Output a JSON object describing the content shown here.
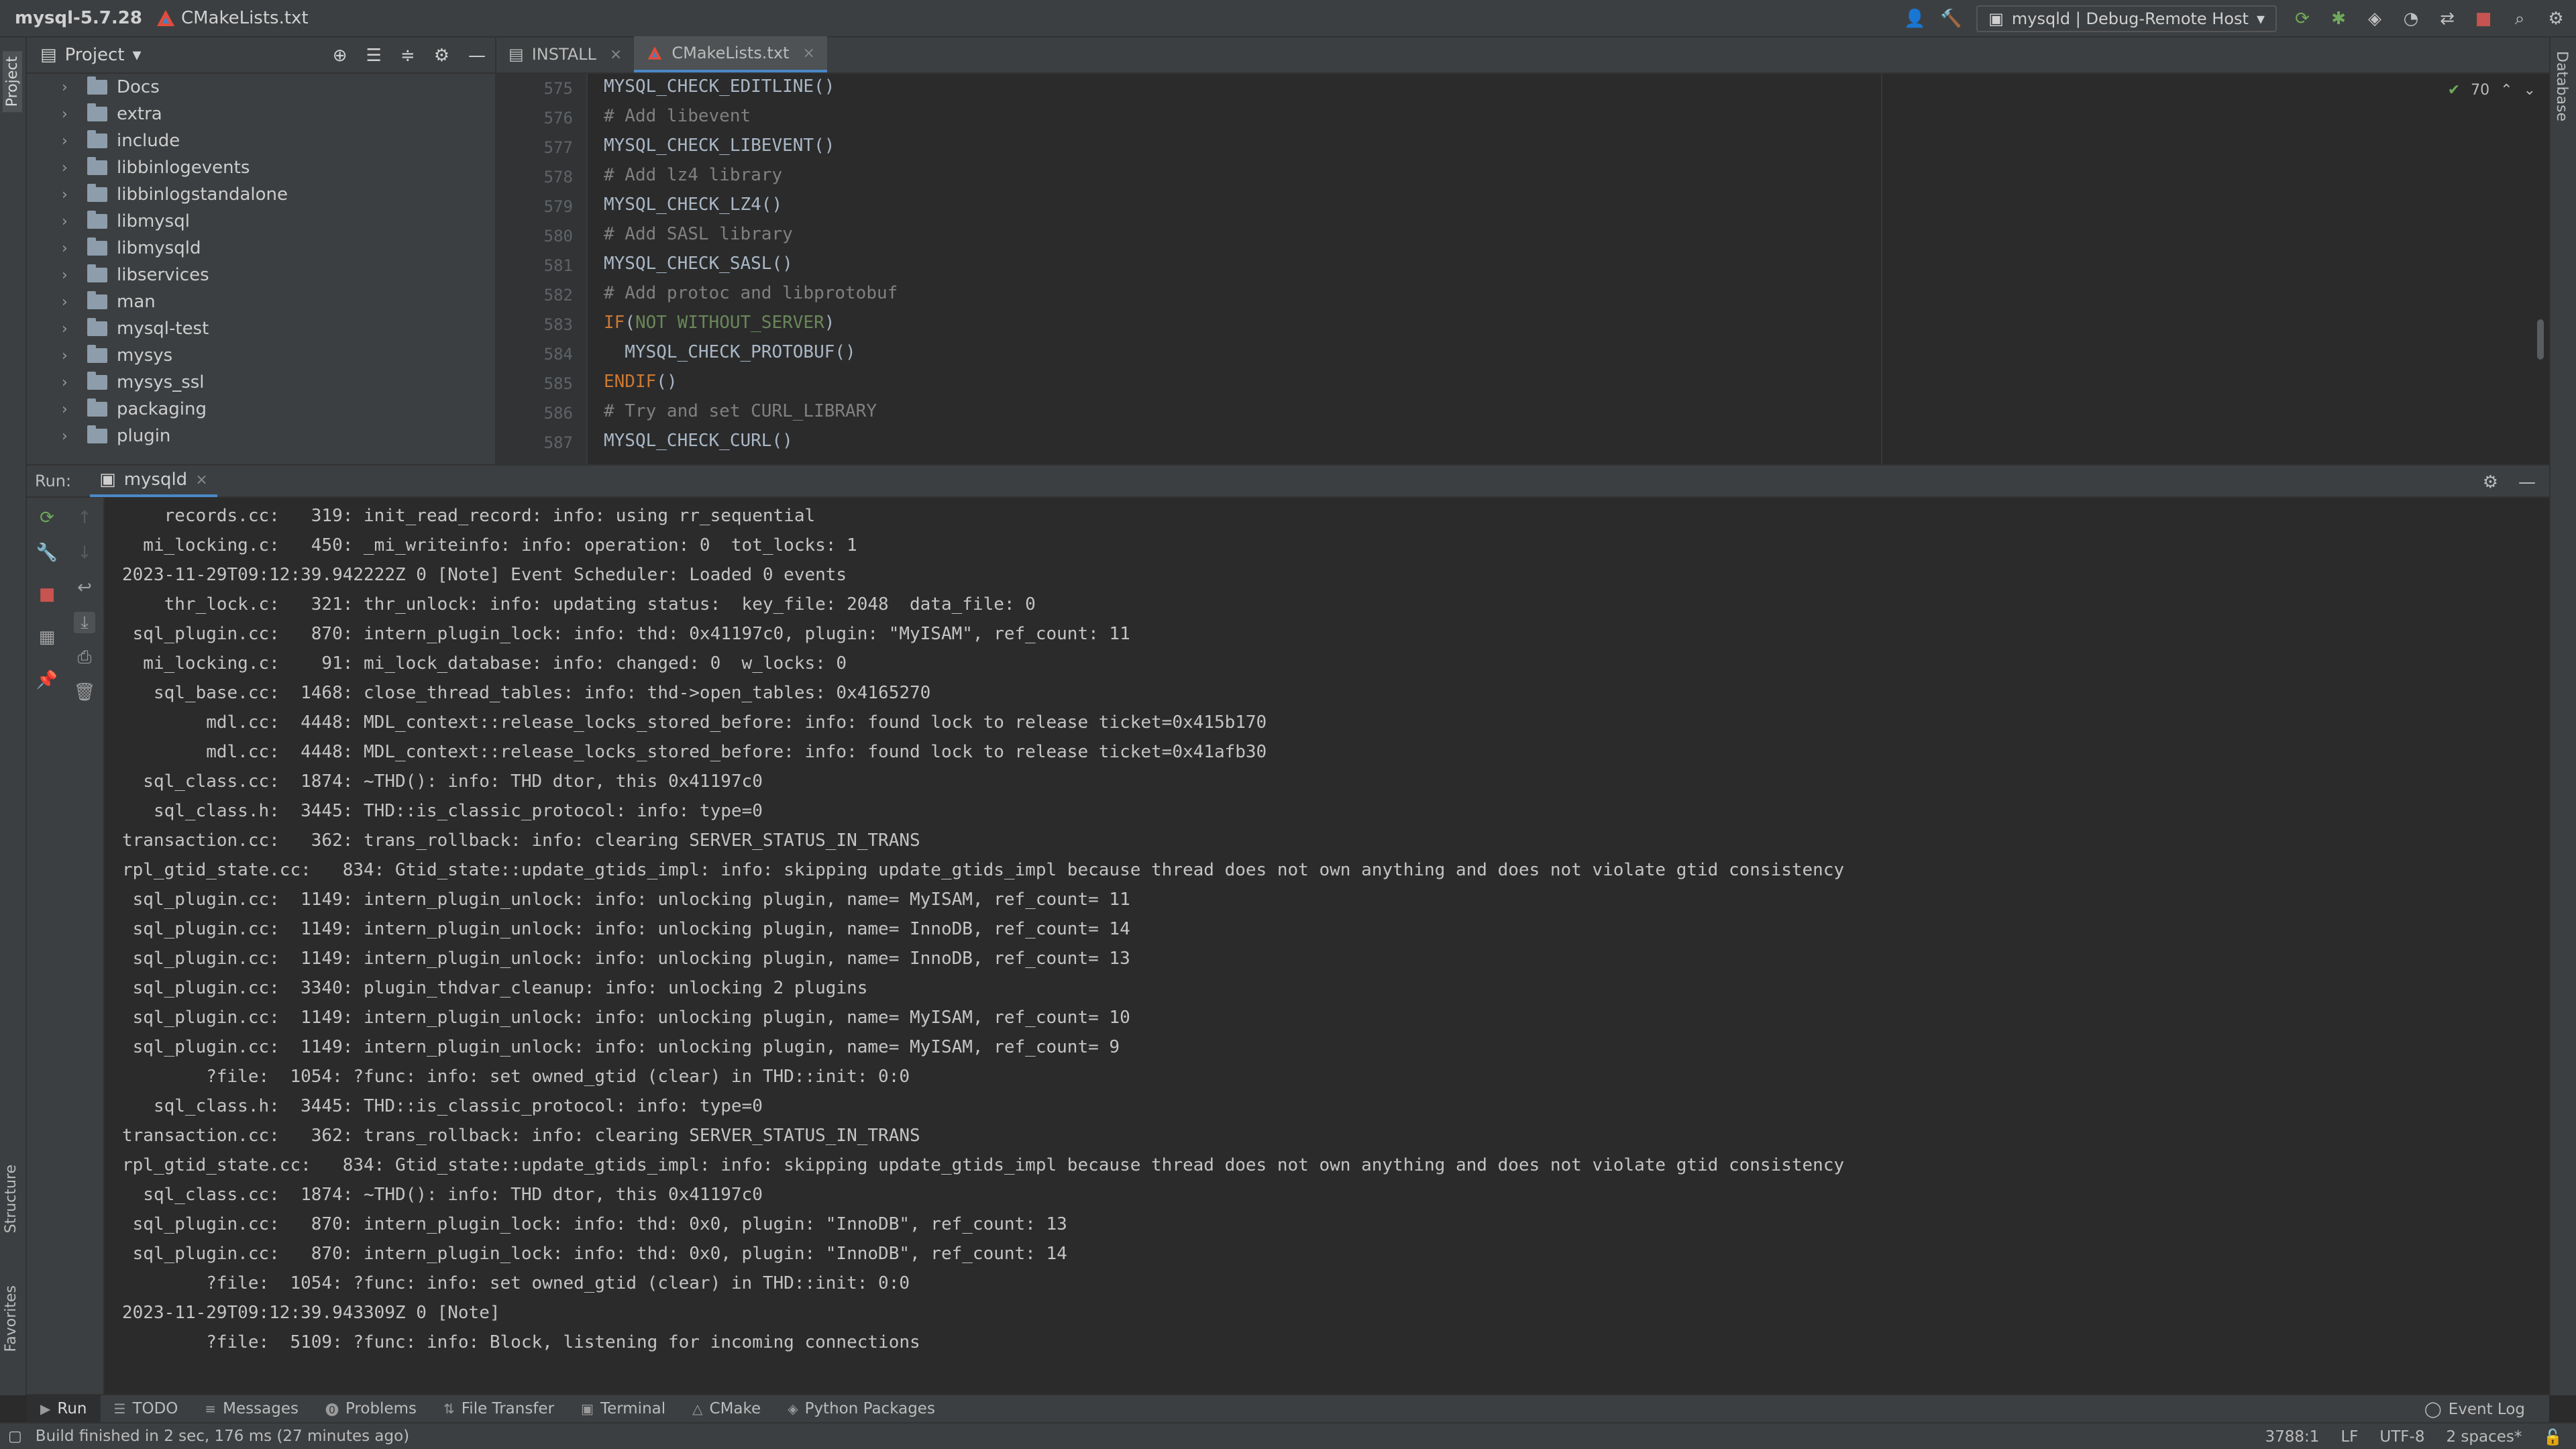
{
  "titlebar": {
    "project": "mysql-5.7.28",
    "file": "CMakeLists.txt",
    "run_config": "mysqld | Debug-Remote Host"
  },
  "left_strip": {
    "project_tab": "Project",
    "structure_tab": "Structure",
    "favorites_tab": "Favorites"
  },
  "right_strip": {
    "database_tab": "Database"
  },
  "project_panel": {
    "title": "Project",
    "items": [
      "Docs",
      "extra",
      "include",
      "libbinlogevents",
      "libbinlogstandalone",
      "libmysql",
      "libmysqld",
      "libservices",
      "man",
      "mysql-test",
      "mysys",
      "mysys_ssl",
      "packaging",
      "plugin"
    ]
  },
  "editor": {
    "tabs": [
      {
        "label": "INSTALL",
        "active": false
      },
      {
        "label": "CMakeLists.txt",
        "active": true
      }
    ],
    "inspection_count": "70",
    "lines": [
      {
        "num": "575",
        "text": "MYSQL_CHECK_EDITLINE()"
      },
      {
        "num": "576",
        "text": "# Add libevent"
      },
      {
        "num": "577",
        "text": "MYSQL_CHECK_LIBEVENT()"
      },
      {
        "num": "578",
        "text": "# Add lz4 library"
      },
      {
        "num": "579",
        "text": "MYSQL_CHECK_LZ4()"
      },
      {
        "num": "580",
        "text": "# Add SASL library"
      },
      {
        "num": "581",
        "text": "MYSQL_CHECK_SASL()"
      },
      {
        "num": "582",
        "text": "# Add protoc and libprotobuf"
      },
      {
        "num": "583",
        "text_kw": "IF",
        "text_arg": "NOT WITHOUT_SERVER",
        "text": "IF(NOT WITHOUT_SERVER)"
      },
      {
        "num": "584",
        "text": "  MYSQL_CHECK_PROTOBUF()"
      },
      {
        "num": "585",
        "text_kw": "ENDIF",
        "text": "ENDIF()"
      },
      {
        "num": "586",
        "text": "# Try and set CURL_LIBRARY"
      },
      {
        "num": "587",
        "text": "MYSQL_CHECK_CURL()"
      }
    ]
  },
  "run_panel": {
    "label": "Run:",
    "tab": "mysqld",
    "console": [
      "    records.cc:   319: init_read_record: info: using rr_sequential",
      "  mi_locking.c:   450: _mi_writeinfo: info: operation: 0  tot_locks: 1",
      "2023-11-29T09:12:39.942222Z 0 [Note] Event Scheduler: Loaded 0 events",
      "    thr_lock.c:   321: thr_unlock: info: updating status:  key_file: 2048  data_file: 0",
      " sql_plugin.cc:   870: intern_plugin_lock: info: thd: 0x41197c0, plugin: \"MyISAM\", ref_count: 11",
      "  mi_locking.c:    91: mi_lock_database: info: changed: 0  w_locks: 0",
      "   sql_base.cc:  1468: close_thread_tables: info: thd->open_tables: 0x4165270",
      "        mdl.cc:  4448: MDL_context::release_locks_stored_before: info: found lock to release ticket=0x415b170",
      "        mdl.cc:  4448: MDL_context::release_locks_stored_before: info: found lock to release ticket=0x41afb30",
      "  sql_class.cc:  1874: ~THD(): info: THD dtor, this 0x41197c0",
      "   sql_class.h:  3445: THD::is_classic_protocol: info: type=0",
      "transaction.cc:   362: trans_rollback: info: clearing SERVER_STATUS_IN_TRANS",
      "rpl_gtid_state.cc:   834: Gtid_state::update_gtids_impl: info: skipping update_gtids_impl because thread does not own anything and does not violate gtid consistency",
      " sql_plugin.cc:  1149: intern_plugin_unlock: info: unlocking plugin, name= MyISAM, ref_count= 11",
      " sql_plugin.cc:  1149: intern_plugin_unlock: info: unlocking plugin, name= InnoDB, ref_count= 14",
      " sql_plugin.cc:  1149: intern_plugin_unlock: info: unlocking plugin, name= InnoDB, ref_count= 13",
      " sql_plugin.cc:  3340: plugin_thdvar_cleanup: info: unlocking 2 plugins",
      " sql_plugin.cc:  1149: intern_plugin_unlock: info: unlocking plugin, name= MyISAM, ref_count= 10",
      " sql_plugin.cc:  1149: intern_plugin_unlock: info: unlocking plugin, name= MyISAM, ref_count= 9",
      "        ?file:  1054: ?func: info: set owned_gtid (clear) in THD::init: 0:0",
      "   sql_class.h:  3445: THD::is_classic_protocol: info: type=0",
      "transaction.cc:   362: trans_rollback: info: clearing SERVER_STATUS_IN_TRANS",
      "rpl_gtid_state.cc:   834: Gtid_state::update_gtids_impl: info: skipping update_gtids_impl because thread does not own anything and does not violate gtid consistency",
      "  sql_class.cc:  1874: ~THD(): info: THD dtor, this 0x41197c0",
      " sql_plugin.cc:   870: intern_plugin_lock: info: thd: 0x0, plugin: \"InnoDB\", ref_count: 13",
      " sql_plugin.cc:   870: intern_plugin_lock: info: thd: 0x0, plugin: \"InnoDB\", ref_count: 14",
      "        ?file:  1054: ?func: info: set owned_gtid (clear) in THD::init: 0:0",
      "2023-11-29T09:12:39.943309Z 0 [Note]",
      "        ?file:  5109: ?func: info: Block, listening for incoming connections"
    ]
  },
  "bottom_tabs": [
    {
      "label": "Run",
      "icon": "play-icon"
    },
    {
      "label": "TODO",
      "icon": "list-icon"
    },
    {
      "label": "Messages",
      "icon": "messages-icon"
    },
    {
      "label": "Problems",
      "icon": "problems-icon"
    },
    {
      "label": "File Transfer",
      "icon": "transfer-icon"
    },
    {
      "label": "Terminal",
      "icon": "terminal-icon"
    },
    {
      "label": "CMake",
      "icon": "cmake-icon"
    },
    {
      "label": "Python Packages",
      "icon": "packages-icon"
    }
  ],
  "event_log": "Event Log",
  "status": {
    "message": "Build finished in 2 sec, 176 ms (27 minutes ago)",
    "position": "3788:1",
    "line_sep": "LF",
    "encoding": "UTF-8",
    "indent": "2 spaces*"
  },
  "colors": {
    "accent": "#4a88c7",
    "comment": "#808080",
    "keyword": "#cc7832",
    "string": "#6a8759",
    "stop": "#c75450"
  }
}
